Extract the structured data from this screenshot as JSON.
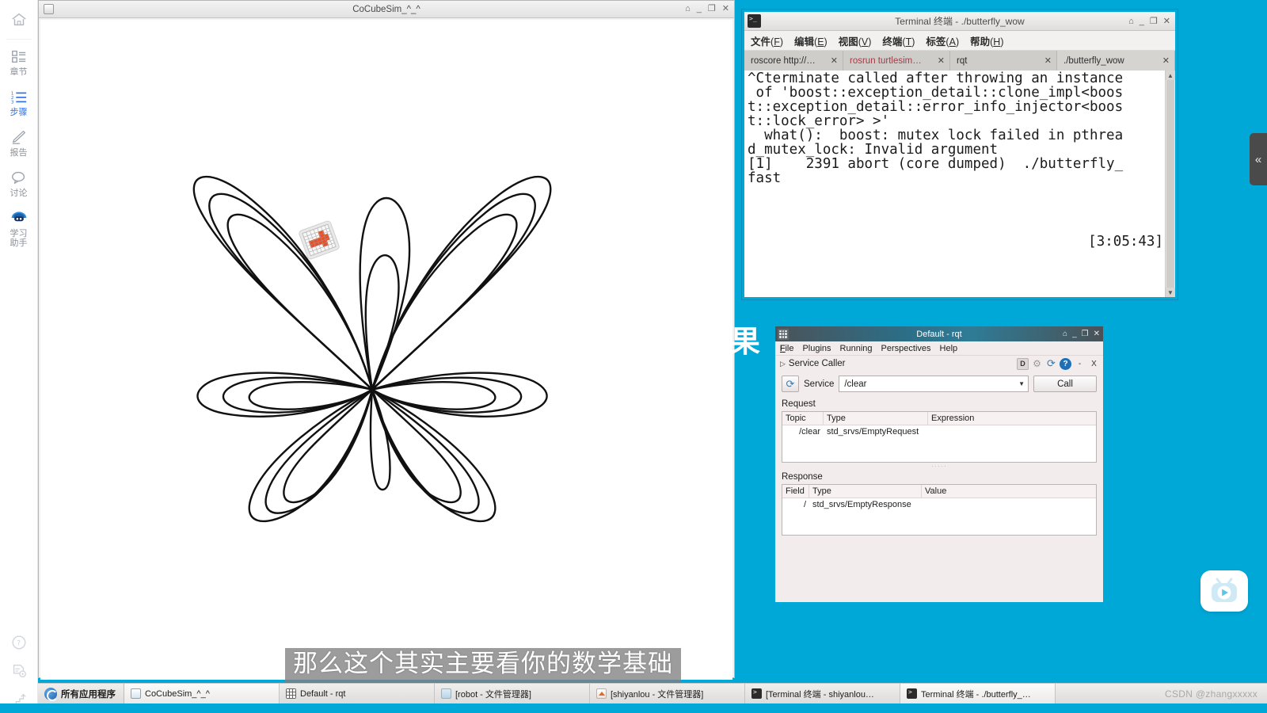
{
  "sidebar": {
    "items": [
      {
        "id": "home",
        "icon": "home-icon",
        "label": ""
      },
      {
        "id": "chapters",
        "icon": "chapters-icon",
        "label": "章节"
      },
      {
        "id": "steps",
        "icon": "steps-icon",
        "label": "步骤",
        "active": true
      },
      {
        "id": "report",
        "icon": "pencil-icon",
        "label": "报告"
      },
      {
        "id": "discuss",
        "icon": "chat-icon",
        "label": "讨论"
      },
      {
        "id": "assistant",
        "icon": "robot-icon",
        "label": "学习\n助手"
      }
    ],
    "bottom_items": [
      {
        "id": "help",
        "icon": "question-circle-icon"
      },
      {
        "id": "feedback",
        "icon": "document-clock-icon"
      },
      {
        "id": "upgrade",
        "icon": "stairs-arrow-icon"
      }
    ]
  },
  "sim_window": {
    "title": "CoCubeSim_^_^",
    "icon": "app-window-icon",
    "buttons": {
      "shade": "⌂",
      "minimize": "_",
      "maximize": "❐",
      "close": "✕"
    },
    "canvas": {
      "turtle": "turtle-robot-sprite",
      "curve": "butterfly-curve"
    }
  },
  "terminal_window": {
    "title": "Terminal 终端 - ./butterfly_wow",
    "icon": "terminal-icon",
    "buttons": {
      "shade": "⌂",
      "minimize": "_",
      "maximize": "❐",
      "close": "✕"
    },
    "menus": [
      {
        "label": "文件",
        "accel": "F"
      },
      {
        "label": "编辑",
        "accel": "E"
      },
      {
        "label": "视图",
        "accel": "V"
      },
      {
        "label": "终端",
        "accel": "T"
      },
      {
        "label": "标签",
        "accel": "A"
      },
      {
        "label": "帮助",
        "accel": "H"
      }
    ],
    "tabs": [
      {
        "label": "roscore http://…",
        "closable": true,
        "warn": false,
        "active": false
      },
      {
        "label": "rosrun turtlesim…",
        "closable": true,
        "warn": true,
        "active": false
      },
      {
        "label": "rqt",
        "closable": true,
        "warn": false,
        "active": false
      },
      {
        "label": "./butterfly_wow",
        "closable": true,
        "warn": false,
        "active": true
      }
    ],
    "output": "^Cterminate called after throwing an instance\n of 'boost::exception_detail::clone_impl<boos\nt::exception_detail::error_info_injector<boos\nt::lock_error> >'\n  what():  boost: mutex lock failed in pthrea\nd_mutex_lock: Invalid argument\n[1]    2391 abort (core dumped)  ./butterfly_\nfast",
    "clock": "[3:05:43]",
    "scroll_up": "▲",
    "scroll_down": "▼"
  },
  "rqt_window": {
    "title": "Default - rqt",
    "icon": "grid-dots-icon",
    "buttons": {
      "shade": "⌂",
      "minimize": "_",
      "maximize": "❐",
      "close": "✕"
    },
    "menus": [
      {
        "label": "File",
        "accel": "F"
      },
      {
        "label": "Plugins",
        "accel": "P"
      },
      {
        "label": "Running",
        "accel": "R"
      },
      {
        "label": "Perspectives",
        "accel": "P"
      },
      {
        "label": "Help",
        "accel": "H"
      }
    ],
    "plugin": {
      "name": "Service Caller",
      "expander": "▷",
      "icons": {
        "dock": "D",
        "settings": "gear-icon",
        "refresh": "refresh-icon",
        "help": "?",
        "minimize": "-",
        "close": "X"
      }
    },
    "service_row": {
      "refresh_icon": "refresh-icon",
      "label": "Service",
      "value": "/clear",
      "caret": "▼",
      "call_button": "Call"
    },
    "request": {
      "title": "Request",
      "headers": [
        "Topic",
        "Type",
        "Expression"
      ],
      "rows": [
        [
          "/clear",
          "std_srvs/EmptyRequest",
          ""
        ]
      ]
    },
    "response": {
      "title": "Response",
      "headers": [
        "Field",
        "Type",
        "Value"
      ],
      "rows": [
        [
          "/",
          "std_srvs/EmptyResponse",
          ""
        ]
      ]
    },
    "splitter_glyph": "·····"
  },
  "right_rail": {
    "collapse_icon": "chevron-double-left-icon",
    "collapse_glyph": "«",
    "badge_icon": "bilibili-tv-icon",
    "hidden_character": "果"
  },
  "subtitle": {
    "text": "那么这个其实主要看你的数学基础"
  },
  "taskbar": {
    "start": {
      "label": "所有应用程序",
      "icon": "start-menu-icon"
    },
    "tasks": [
      {
        "label": "CoCubeSim_^_^",
        "icon": "window-icon",
        "selected": true
      },
      {
        "label": "Default - rqt",
        "icon": "grid-dots-icon",
        "selected": false
      },
      {
        "label": "[robot - 文件管理器]",
        "icon": "folder-icon",
        "selected": false
      },
      {
        "label": "[shiyanlou - 文件管理器]",
        "icon": "home-icon",
        "selected": false
      },
      {
        "label": "[Terminal 终端 - shiyanlou…",
        "icon": "terminal-icon",
        "selected": false
      },
      {
        "label": "Terminal 终端 - ./butterfly_…",
        "icon": "terminal-icon",
        "selected": true
      }
    ],
    "watermark": "CSDN @zhangxxxxx"
  },
  "colors": {
    "accent_cyan": "#00a8d8",
    "sidebar_active": "#2f6fe0",
    "terminal_tab_warn": "#a33a44",
    "rqt_title_gradient": "#2d6d86",
    "turtle_orange": "#e8502a"
  }
}
